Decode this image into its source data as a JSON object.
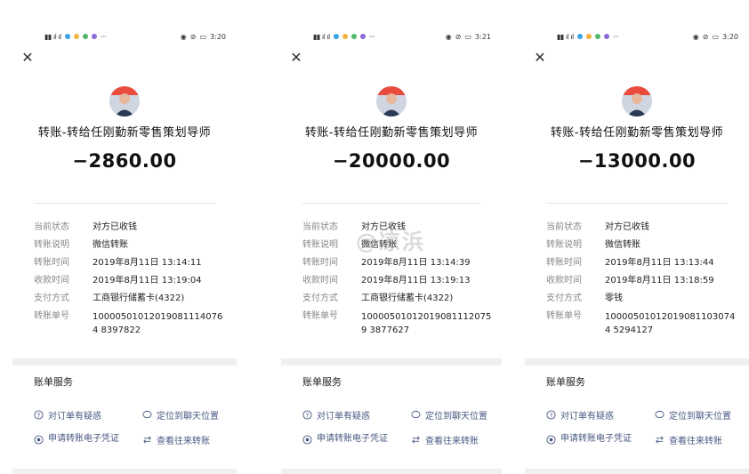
{
  "watermark": "@凉浜",
  "services_title": "账单服务",
  "services": {
    "inquiry": "对订单有疑惑",
    "locate_chat": "定位到聊天位置",
    "e_voucher": "申请转账电子凭证",
    "history": "查看往来转账"
  },
  "labels": {
    "status": "当前状态",
    "note": "转账说明",
    "transfer_time": "转账时间",
    "receive_time": "收款时间",
    "payment_method": "支付方式",
    "transfer_id": "转账单号"
  },
  "receipts": [
    {
      "clock": "3:20",
      "title": "转账-转给任刚勤新零售策划导师",
      "amount": "−2860.00",
      "status": "对方已收钱",
      "note": "微信转账",
      "transfer_time": "2019年8月11日 13:14:11",
      "receive_time": "2019年8月11日 13:19:04",
      "payment_method": "工商银行储蓄卡(4322)",
      "transfer_id": "100005010120190811140764 8397822"
    },
    {
      "clock": "3:21",
      "title": "转账-转给任刚勤新零售策划导师",
      "amount": "−20000.00",
      "status": "对方已收钱",
      "note": "微信转账",
      "transfer_time": "2019年8月11日 13:14:39",
      "receive_time": "2019年8月11日 13:19:13",
      "payment_method": "工商银行储蓄卡(4322)",
      "transfer_id": "100005010120190811120759 3877627"
    },
    {
      "clock": "3:20",
      "title": "转账-转给任刚勤新零售策划导师",
      "amount": "−13000.00",
      "status": "对方已收钱",
      "note": "微信转账",
      "transfer_time": "2019年8月11日 13:13:44",
      "receive_time": "2019年8月11日 13:18:59",
      "payment_method": "零钱",
      "transfer_id": "100005010120190811030744 5294127"
    }
  ]
}
